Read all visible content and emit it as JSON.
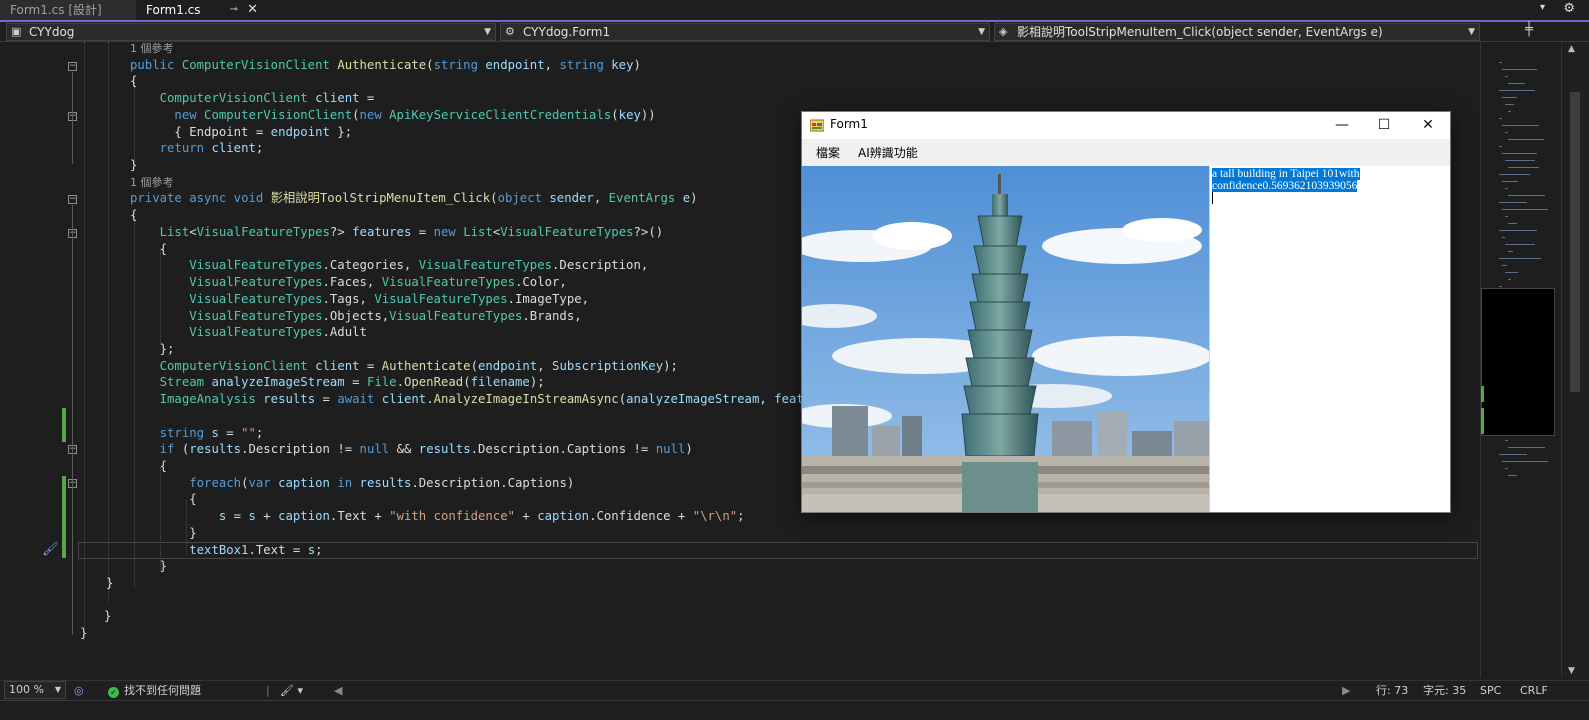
{
  "tabs": [
    {
      "label": "Form1.cs [設計]",
      "active": false
    },
    {
      "label": "Form1.cs",
      "active": true
    }
  ],
  "tab_close_glyph": "✕",
  "tab_pin_glyph": "⊸",
  "navbar": {
    "project": "CYYdog",
    "class": "CYYdog.Form1",
    "member": "影相說明ToolStripMenuItem_Click(object sender, EventArgs e)"
  },
  "code": {
    "lines": [
      "1 個參考",
      "public ComputerVisionClient Authenticate(string endpoint, string key)",
      "{",
      "    ComputerVisionClient client =",
      "      new ComputerVisionClient(new ApiKeyServiceClientCredentials(key))",
      "      { Endpoint = endpoint };",
      "    return client;",
      "}",
      "1 個參考",
      "private async void 影相說明ToolStripMenuItem_Click(object sender, EventArgs e)",
      "{",
      "    List<VisualFeatureTypes?> features = new List<VisualFeatureTypes?>()",
      "    {",
      "        VisualFeatureTypes.Categories, VisualFeatureTypes.Description,",
      "        VisualFeatureTypes.Faces, VisualFeatureTypes.Color,",
      "        VisualFeatureTypes.Tags, VisualFeatureTypes.ImageType,",
      "        VisualFeatureTypes.Objects,VisualFeatureTypes.Brands,",
      "        VisualFeatureTypes.Adult",
      "    };",
      "    ComputerVisionClient client = Authenticate(endpoint, SubscriptionKey);",
      "    Stream analyzeImageStream = File.OpenRead(filename);",
      "    ImageAnalysis results = await client.AnalyzeImageInStreamAsync(analyzeImageStream, features);",
      "",
      "    string s = \"\";",
      "    if (results.Description != null && results.Description.Captions != null)",
      "    {",
      "        foreach(var caption in results.Description.Captions)",
      "        {",
      "            s = s + caption.Text + \"with confidence\" + caption.Confidence + \"\\r\\n\";",
      "        }",
      "        textBox1.Text = s;",
      "    }",
      "}",
      "",
      "}",
      "}"
    ]
  },
  "status": {
    "zoom": "100 %",
    "issues": "找不到任何問題",
    "line": "行: 73",
    "col": "字元: 35",
    "spaces": "SPC",
    "eol": "CRLF"
  },
  "form": {
    "title": "Form1",
    "menu": [
      "檔案",
      "AI辨識功能"
    ],
    "caption_line1": "a tall building in Taipei 101with",
    "caption_line2": "confidence0.569362103939056",
    "picture_alt": "Taipei 101 tower with blue sky and clouds",
    "buttons": {
      "minimize": "—",
      "maximize": "☐",
      "close": "✕"
    }
  },
  "colors": {
    "accent": "#7f5fd1",
    "change_bar": "#57a64a",
    "selection": "#0078d7",
    "editor_bg": "#1e1e1e"
  }
}
